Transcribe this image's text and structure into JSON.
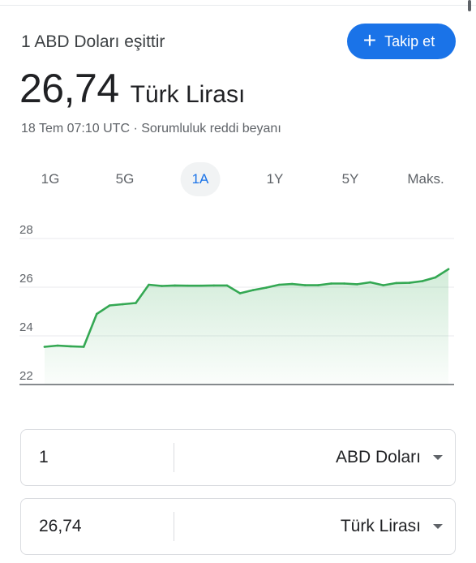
{
  "header": {
    "subtitle": "1 ABD Doları eşittir",
    "follow_label": "Takip et",
    "amount": "26,74",
    "currency": "Türk Lirası",
    "timestamp": "18 Tem 07:10 UTC",
    "separator": " · ",
    "disclaimer": "Sorumluluk reddi beyanı"
  },
  "tabs": [
    {
      "label": "1G",
      "active": false
    },
    {
      "label": "5G",
      "active": false
    },
    {
      "label": "1A",
      "active": true
    },
    {
      "label": "1Y",
      "active": false
    },
    {
      "label": "5Y",
      "active": false
    },
    {
      "label": "Maks.",
      "active": false
    }
  ],
  "chart_data": {
    "type": "area",
    "title": "",
    "xlabel": "",
    "ylabel": "",
    "yticks": [
      "28",
      "26",
      "24",
      "22"
    ],
    "ylim": [
      22,
      28
    ],
    "grid": true,
    "line_color": "#34a853",
    "values": [
      23.55,
      23.6,
      23.57,
      23.55,
      24.9,
      25.25,
      25.3,
      25.35,
      26.1,
      26.05,
      26.07,
      26.06,
      26.06,
      26.07,
      26.07,
      25.75,
      25.88,
      25.98,
      26.1,
      26.13,
      26.08,
      26.08,
      26.15,
      26.15,
      26.12,
      26.2,
      26.08,
      26.17,
      26.18,
      26.25,
      26.4,
      26.74
    ]
  },
  "converter": {
    "from": {
      "value": "1",
      "unit": "ABD Doları"
    },
    "to": {
      "value": "26,74",
      "unit": "Türk Lirası"
    }
  },
  "colors": {
    "accent": "#1a73e8",
    "line": "#34a853"
  }
}
